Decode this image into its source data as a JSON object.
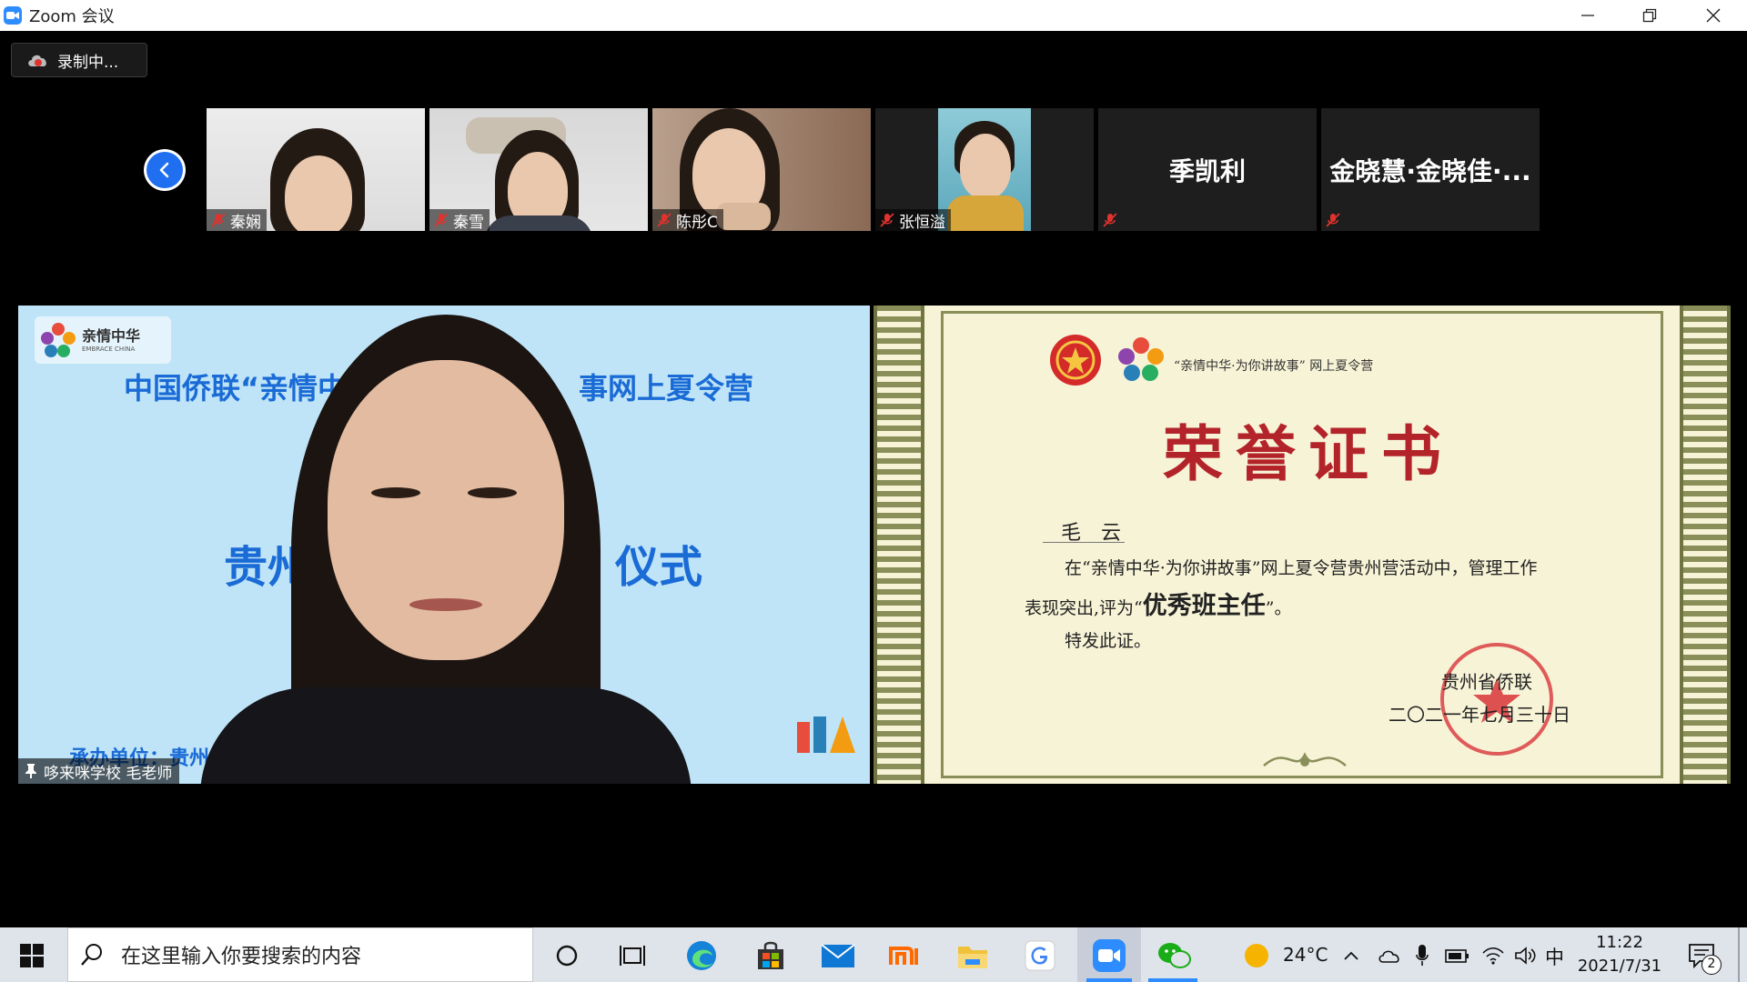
{
  "window": {
    "title": "Zoom 会议"
  },
  "recording": {
    "label": "录制中..."
  },
  "participants": [
    {
      "name": "秦娴"
    },
    {
      "name": "秦雪"
    },
    {
      "name": "陈彤C"
    },
    {
      "name": "张恒溢"
    },
    {
      "name": "季凯利"
    },
    {
      "name": "金晓慧·金晓佳·..."
    }
  ],
  "speaker": {
    "name": "哆来咪学校 毛老师",
    "slide_logo_cn": "亲情中华",
    "slide_logo_en": "EMBRACE CHINA",
    "slide_line1a": "中国侨联“亲情中",
    "slide_line1b": "事网上夏令营",
    "slide_line2a": "贵州营",
    "slide_line2b": "仪式",
    "slide_footer": "承办单位：贵州"
  },
  "certificate": {
    "header": "“亲情中华·为你讲故事” 网上夏令营",
    "title": "荣誉证书",
    "recipient": "毛　云",
    "body1": "在“亲情中华·为你讲故事”网上夏令营贵州营活动中，管理工作",
    "body2_prefix": "表现突出,评为“",
    "award": "优秀班主任",
    "body2_suffix": "”。",
    "body3": "特发此证。",
    "issuer": "贵州省侨联",
    "date": "二〇二一年七月三十日"
  },
  "taskbar": {
    "search_placeholder": "在这里输入你要搜索的内容",
    "weather": "24°C",
    "ime": "中",
    "time": "11:22",
    "date": "2021/7/31",
    "notification_count": "2"
  },
  "colors": {
    "zoom_blue": "#2d8cff",
    "nav_blue": "#1f6ff0",
    "slide_blue": "#1a6bd6",
    "cert_red": "#b3232a",
    "muted_red": "#e0332e"
  }
}
